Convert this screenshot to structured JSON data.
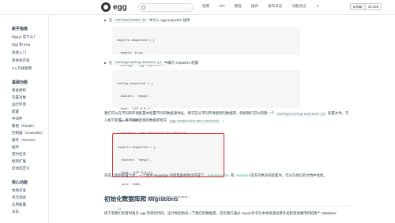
{
  "topbar": {
    "logo_text": "egg",
    "nav": [
      "指南",
      "API",
      "教程",
      "插件",
      "发布日志",
      "功能语言"
    ],
    "github": {
      "star_label": "Star",
      "count": "19,048"
    }
  },
  "sidebar": {
    "section_1": "新手指南",
    "items_1": [
      "Egg.js 是什么？",
      "Egg 和 Koa",
      "快速入门",
      "渐进式开发",
      "3.x 升级指南"
    ],
    "section_2": "基础功能",
    "items_2": [
      "目录结构",
      "内置对象",
      "运行环境",
      "配置",
      "中间件",
      "路由（Router）",
      "控制器（Controller）",
      "服务（Service）",
      "插件",
      "定时任务",
      "框架扩展",
      "启动自定义"
    ],
    "section_3": "核心功能",
    "items_3": [
      "本地开发",
      "单元测试",
      "应用部署",
      "日志"
    ]
  },
  "content": {
    "step1": {
      "prefix": "在",
      "file": "config/plugin.js",
      "suffix": "中引入 egg-sequelize 插件"
    },
    "code1": [
      "exports.sequelize = {",
      "  enable: true,",
      "  package: 'egg-sequelize',",
      "};"
    ],
    "step2": {
      "prefix": "在",
      "file": "config/config.default.js",
      "suffix": "中编写 sequelize 配置"
    },
    "code2": [
      "config.sequelize = {",
      "  dialect: 'mysql',",
      "  host: '127.0.0.1',",
      "  port: 3306,",
      "  database: 'egg-sequelize-doc-default',",
      "};"
    ],
    "para1": {
      "text_a": "我们可以在不同的环境配置中配置不同的数据源地址，用于区分不同环境使用的数据库，例如我们可以新建一个",
      "file": "config/config.unittest.js",
      "text_b": "配置文件，写入如下配置，将单测时连接的数据库指向",
      "db": "egg-sequelize-doc-unittest",
      "text_c": "。"
    },
    "code3": [
      "exports.sequelize = {",
      "  dialect: 'mysql',",
      "  host: '127.0.0.1',",
      "  port: 3306,",
      "  database: 'egg-sequelize-doc-unittest',",
      "};"
    ],
    "para2": {
      "text_a": "完成上面的配置之后，一个使用 sequelize 的项目就初始化完成了。",
      "link1": "egg-sequelize",
      "text_b": "和",
      "link2": "sequelize",
      "text_c": "还支持更多的配置项，可以在他们的文档中找到。"
    },
    "heading": "初始化数据库和 Migrations",
    "para3": "接下来我们先暂时离开 egg 项目的代码，设计和初始化一下我们的数据库。首先我们通过 mysql 命令在本地快速创建开发和测试要用到的两个 database："
  },
  "colors": {
    "accent": "#3eaf7c",
    "highlight_border": "#e02a2a",
    "code_bg": "#f6f6f6"
  }
}
